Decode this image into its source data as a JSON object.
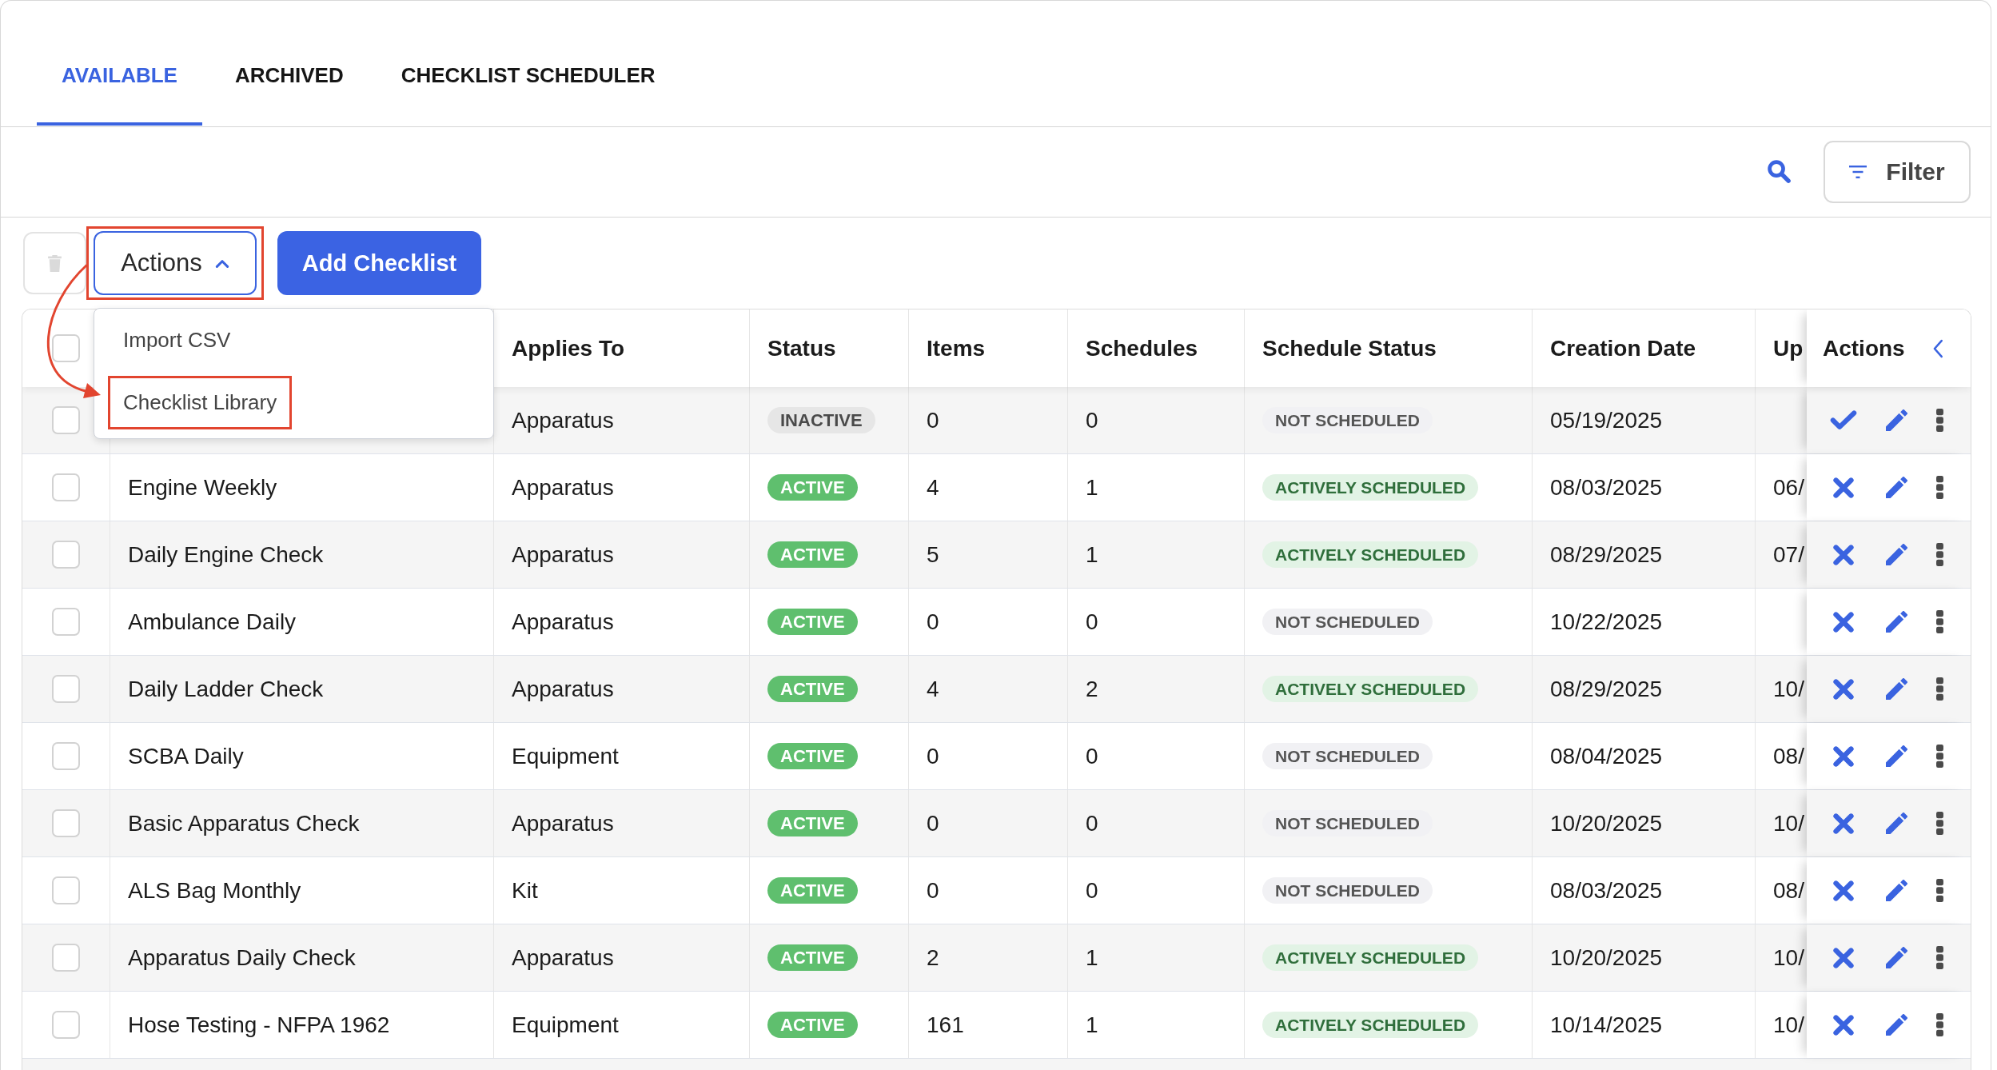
{
  "tabs": [
    {
      "label": "AVAILABLE",
      "selected": true
    },
    {
      "label": "ARCHIVED",
      "selected": false
    },
    {
      "label": "CHECKLIST SCHEDULER",
      "selected": false
    }
  ],
  "toolbar": {
    "filter_button": {
      "label": "Filter"
    }
  },
  "actions_bar": {
    "delete_button": {
      "disabled": true
    },
    "actions_menu": {
      "label": "Actions",
      "expanded": true,
      "highlighted": true,
      "items": [
        {
          "label": "Import CSV",
          "highlighted": false
        },
        {
          "label": "Checklist Library",
          "highlighted": true
        }
      ]
    },
    "add_button": {
      "label": "Add Checklist"
    }
  },
  "table": {
    "select_all": {
      "checked": false
    },
    "columns": {
      "applies_to": "Applies To",
      "status": "Status",
      "items": "Items",
      "schedules": "Schedules",
      "schedule_status": "Schedule Status",
      "creation_date": "Creation Date",
      "column_8": "Up",
      "actions": "Actions"
    },
    "rows": [
      {
        "checked": false,
        "applies_to": "Apparatus",
        "status": {
          "label": "INACTIVE",
          "kind": "inactive"
        },
        "items": "0",
        "schedules": "0",
        "schedule_status": {
          "label": "NOT SCHEDULED",
          "kind": "not_scheduled"
        },
        "creation_date": "05/19/2025"
      },
      {
        "checked": false,
        "name": "Engine Weekly",
        "applies_to": "Apparatus",
        "status": {
          "label": "ACTIVE",
          "kind": "active"
        },
        "items": "4",
        "schedules": "1",
        "schedule_status": {
          "label": "ACTIVELY SCHEDULED",
          "kind": "scheduled"
        },
        "creation_date": "08/03/2025",
        "column_8": "06/"
      },
      {
        "checked": false,
        "name": "Daily Engine Check",
        "applies_to": "Apparatus",
        "status": {
          "label": "ACTIVE",
          "kind": "active"
        },
        "items": "5",
        "schedules": "1",
        "schedule_status": {
          "label": "ACTIVELY SCHEDULED",
          "kind": "scheduled"
        },
        "creation_date": "08/29/2025",
        "column_8": "07/"
      },
      {
        "checked": false,
        "name": "Ambulance Daily",
        "applies_to": "Apparatus",
        "status": {
          "label": "ACTIVE",
          "kind": "active"
        },
        "items": "0",
        "schedules": "0",
        "schedule_status": {
          "label": "NOT SCHEDULED",
          "kind": "not_scheduled"
        },
        "creation_date": "10/22/2025"
      },
      {
        "checked": false,
        "name": "Daily Ladder Check",
        "applies_to": "Apparatus",
        "status": {
          "label": "ACTIVE",
          "kind": "active"
        },
        "items": "4",
        "schedules": "2",
        "schedule_status": {
          "label": "ACTIVELY SCHEDULED",
          "kind": "scheduled"
        },
        "creation_date": "08/29/2025",
        "column_8": "10/"
      },
      {
        "checked": false,
        "name": "SCBA Daily",
        "applies_to": "Equipment",
        "status": {
          "label": "ACTIVE",
          "kind": "active"
        },
        "items": "0",
        "schedules": "0",
        "schedule_status": {
          "label": "NOT SCHEDULED",
          "kind": "not_scheduled"
        },
        "creation_date": "08/04/2025",
        "column_8": "08/"
      },
      {
        "checked": false,
        "name": "Basic Apparatus Check",
        "applies_to": "Apparatus",
        "status": {
          "label": "ACTIVE",
          "kind": "active"
        },
        "items": "0",
        "schedules": "0",
        "schedule_status": {
          "label": "NOT SCHEDULED",
          "kind": "not_scheduled"
        },
        "creation_date": "10/20/2025",
        "column_8": "10/"
      },
      {
        "checked": false,
        "name": "ALS Bag Monthly",
        "applies_to": "Kit",
        "status": {
          "label": "ACTIVE",
          "kind": "active"
        },
        "items": "0",
        "schedules": "0",
        "schedule_status": {
          "label": "NOT SCHEDULED",
          "kind": "not_scheduled"
        },
        "creation_date": "08/03/2025",
        "column_8": "08/"
      },
      {
        "checked": false,
        "name": "Apparatus Daily Check",
        "applies_to": "Apparatus",
        "status": {
          "label": "ACTIVE",
          "kind": "active"
        },
        "items": "2",
        "schedules": "1",
        "schedule_status": {
          "label": "ACTIVELY SCHEDULED",
          "kind": "scheduled"
        },
        "creation_date": "10/20/2025",
        "column_8": "10/"
      },
      {
        "checked": false,
        "name": "Hose Testing - NFPA 1962",
        "applies_to": "Equipment",
        "status": {
          "label": "ACTIVE",
          "kind": "active"
        },
        "items": "161",
        "schedules": "1",
        "schedule_status": {
          "label": "ACTIVELY SCHEDULED",
          "kind": "scheduled"
        },
        "creation_date": "10/14/2025",
        "column_8": "10/"
      }
    ]
  }
}
